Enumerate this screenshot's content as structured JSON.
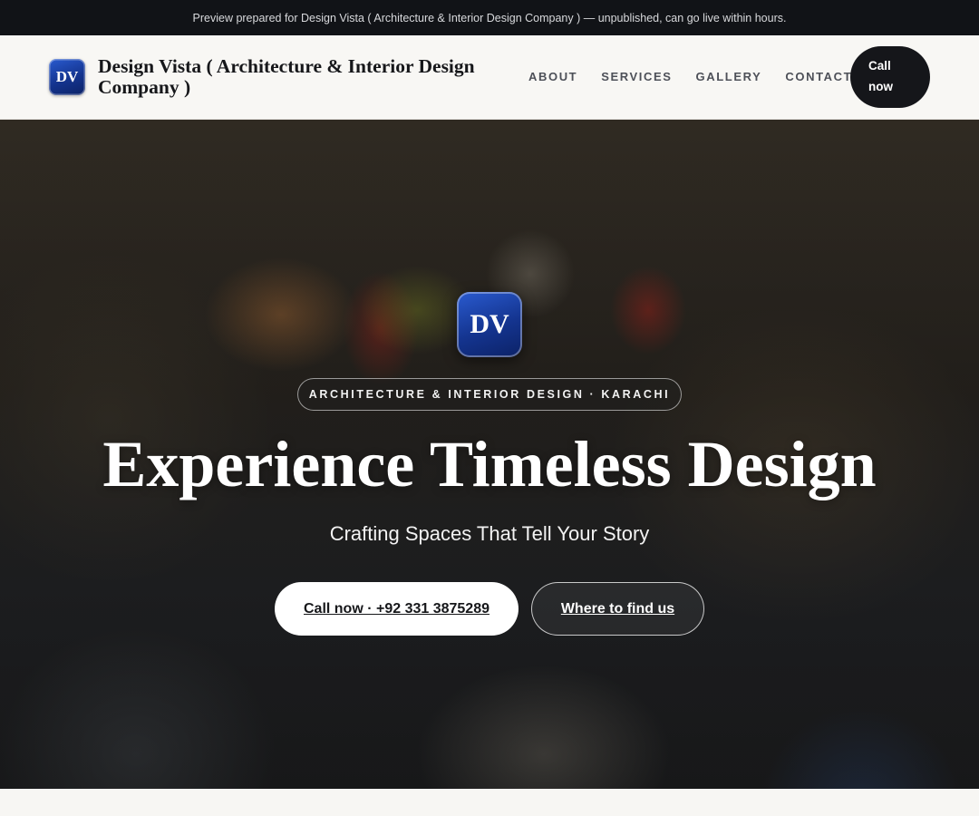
{
  "topbar": {
    "notice": "Preview prepared for Design Vista ( Architecture & Interior Design Company ) — unpublished, can go live within hours."
  },
  "header": {
    "logo_text": "DV",
    "brand_name": "Design Vista ( Architecture & Interior Design Company )",
    "nav": [
      {
        "label": "ABOUT"
      },
      {
        "label": "SERVICES"
      },
      {
        "label": "GALLERY"
      },
      {
        "label": "CONTACT"
      }
    ],
    "call_line1": "Call",
    "call_line2": "now"
  },
  "hero": {
    "logo_text": "DV",
    "eyebrow": "ARCHITECTURE & INTERIOR DESIGN · KARACHI",
    "title": "Experience Timeless Design",
    "subtitle": "Crafting Spaces That Tell Your Story",
    "primary_cta": "Call now · +92 331 3875289",
    "secondary_cta": "Where to find us"
  },
  "colors": {
    "brand_blue": "#1a3fa8",
    "dark": "#15161a",
    "topbar_bg": "#111317"
  }
}
